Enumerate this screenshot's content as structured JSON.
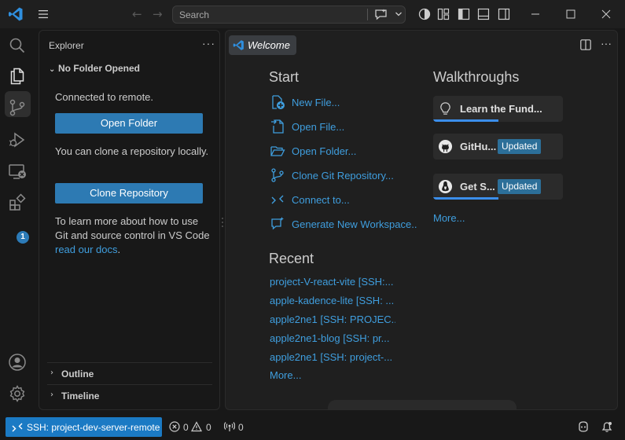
{
  "titlebar": {
    "search_placeholder": "Search",
    "back_icon": "←",
    "forward_icon": "→"
  },
  "activity": {
    "extensions_badge": "1"
  },
  "sidebar": {
    "title": "Explorer",
    "more": "···",
    "section": "No Folder Opened",
    "connected": "Connected to remote.",
    "open_folder": "Open Folder",
    "clone_text": "You can clone a repository locally.",
    "clone_button": "Clone Repository",
    "docs_text": "To learn more about how to use Git and source control in VS Code",
    "docs_link": "read our docs",
    "docs_end": ".",
    "outline": "Outline",
    "timeline": "Timeline"
  },
  "editor": {
    "tab_label": "Welcome",
    "more": "···",
    "start_heading": "Start",
    "start_items": [
      {
        "label": "New File...",
        "icon": "new-file-icon"
      },
      {
        "label": "Open File...",
        "icon": "open-file-icon"
      },
      {
        "label": "Open Folder...",
        "icon": "open-folder-icon"
      },
      {
        "label": "Clone Git Repository...",
        "icon": "source-control-icon"
      },
      {
        "label": "Connect to...",
        "icon": "remote-connect-icon"
      },
      {
        "label": "Generate New Workspace...",
        "icon": "sparkle-chat-icon"
      }
    ],
    "recent_heading": "Recent",
    "recent_items": [
      "project-V-react-vite [SSH:...",
      "apple-kadence-lite [SSH: ...",
      "apple2ne1 [SSH: PROJEC...",
      "apple2ne1-blog [SSH: pr...",
      "apple2ne1 [SSH: project-..."
    ],
    "recent_more": "More...",
    "walkthroughs_heading": "Walkthroughs",
    "walkthroughs": [
      {
        "label": "Learn the Fund...",
        "badge": "",
        "progress": 0.5,
        "icon": "lightbulb-icon"
      },
      {
        "label": "GitHu...",
        "badge": "Updated",
        "progress": 0,
        "icon": "github-icon"
      },
      {
        "label": "Get S...",
        "badge": "Updated",
        "progress": 0.5,
        "icon": "linux-icon"
      }
    ],
    "walkthroughs_more": "More..."
  },
  "statusbar": {
    "remote_label": "SSH: project-dev-server-remote",
    "errors": "0",
    "warnings": "0",
    "ports": "0"
  },
  "colors": {
    "accent": "#2d7ab3",
    "link": "#3f9ede",
    "remote": "#1b7ac4",
    "badge": "#2c6f99"
  }
}
